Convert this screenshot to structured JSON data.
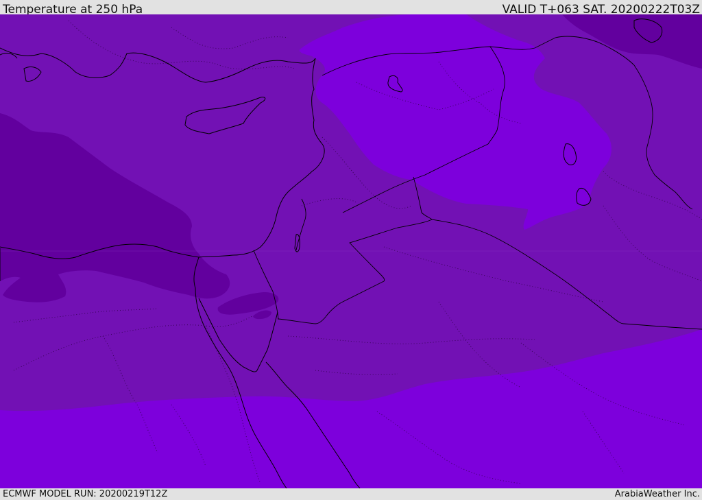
{
  "header": {
    "title": "Temperature at 250 hPa",
    "valid": "VALID T+063 SAT. 20200222T03Z"
  },
  "footer": {
    "model_run": "ECMWF MODEL RUN: 20200219T12Z",
    "credit": "ArabiaWeather Inc."
  },
  "colors": {
    "dark": "#62009e",
    "mid": "#7211b4",
    "light": "#7d00dc",
    "border": "#000000",
    "bar": "#e2e2e2"
  }
}
